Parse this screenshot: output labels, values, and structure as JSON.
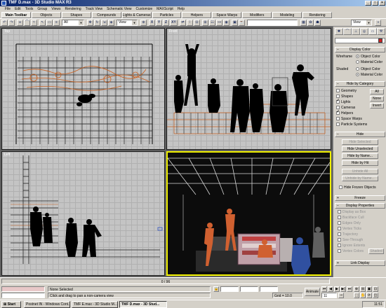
{
  "window": {
    "title": "TMF D.max - 3D Studio MAX R3"
  },
  "menu": [
    "File",
    "Edit",
    "Tools",
    "Group",
    "Views",
    "Rendering",
    "Track View",
    "Schematic View",
    "Customize",
    "MAXScript",
    "Help"
  ],
  "tabs": [
    "Main Toolbar",
    "Objects",
    "Shapes",
    "Compounds",
    "Lights & Cameras",
    "Particles",
    "Helpers",
    "Space Warps",
    "Modifiers",
    "Modeling",
    "Rendering"
  ],
  "toolbar": {
    "selection_filter": "All",
    "coord_system": "View",
    "axis_x": "X",
    "axis_y": "Y",
    "axis_z": "Z",
    "axis_xy": "XY",
    "named_sel": "View"
  },
  "viewports": {
    "top": "Top",
    "front": "Front",
    "left": "Left",
    "perspective": ""
  },
  "cmdpanel": {
    "display_color": {
      "header": "Display Color",
      "wireframe": "Wireframe",
      "shaded": "Shaded",
      "object_color": "Object Color",
      "material_color": "Material Color"
    },
    "hide_by_category": {
      "header": "Hide by Category",
      "items": [
        "Geometry",
        "Shapes",
        "Lights",
        "Cameras",
        "Helpers",
        "Space Warps",
        "Particle Systems"
      ],
      "all": "All",
      "none": "None",
      "invert": "Invert"
    },
    "hide": {
      "header": "Hide",
      "hide_selected": "Hide Selected",
      "hide_unselected": "Hide Unselected",
      "hide_by_name": "Hide by Name...",
      "hide_by_hit": "Hide by Hit",
      "unhide_all": "Unhide All",
      "unhide_by_name": "Unhide by Name...",
      "hide_frozen": "Hide Frozen Objects"
    },
    "freeze": {
      "header": "Freeze"
    },
    "display_properties": {
      "header": "Display Properties",
      "items": [
        "Display as Box",
        "Backface Cull",
        "Edges Only",
        "Vertex Ticks",
        "Trajectory",
        "See-Through",
        "Ignore Extents",
        "Vertex Colors"
      ],
      "shaded_btn": "Shaded"
    },
    "link_display": {
      "header": "Link Display"
    }
  },
  "status": {
    "frame_slider": "0 / 96",
    "selection": "None Selected",
    "prompt": "Click and drag to pan a non-camera view",
    "grid": "Grid = 10.0",
    "animate": "Animate",
    "frame": "11"
  },
  "taskbar": {
    "start": "Start",
    "tasks": [
      "Postnet IN - Windows Cont...",
      "TMF E.max - 3D Studio M...",
      "TMF D.max - 3D Stud..."
    ],
    "clock": "11:51"
  }
}
